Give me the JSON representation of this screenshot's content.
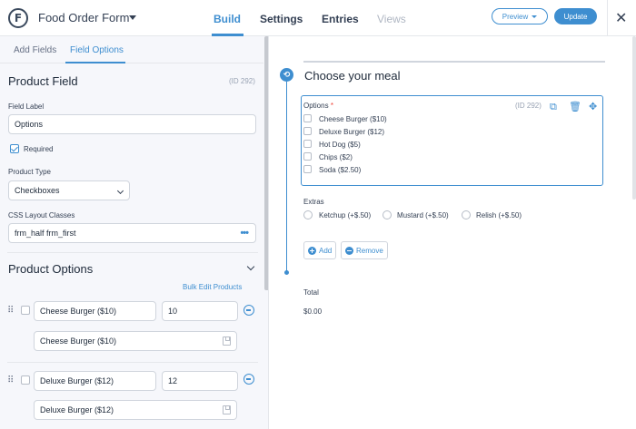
{
  "header": {
    "logo_letter": "F",
    "form_title": "Food Order Form",
    "tabs": [
      {
        "label": "Build",
        "state": "active"
      },
      {
        "label": "Settings",
        "state": "normal"
      },
      {
        "label": "Entries",
        "state": "normal"
      },
      {
        "label": "Views",
        "state": "disabled"
      }
    ],
    "preview_label": "Preview",
    "update_label": "Update",
    "close_glyph": "✕"
  },
  "sidebar": {
    "tabs": [
      {
        "label": "Add Fields"
      },
      {
        "label": "Field Options"
      }
    ],
    "product_field": {
      "title": "Product Field",
      "id_text": "(ID 292)",
      "field_label_label": "Field Label",
      "field_label_value": "Options",
      "required_label": "Required",
      "required_checked": true,
      "product_type_label": "Product Type",
      "product_type_value": "Checkboxes",
      "css_label": "CSS Layout Classes",
      "css_value": "frm_half frm_first",
      "dots_glyph": "•••"
    },
    "product_options": {
      "title": "Product Options",
      "bulk_edit_label": "Bulk Edit Products",
      "drag_glyph": "⠿",
      "items": [
        {
          "name": "Cheese Burger ($10)",
          "price": "10",
          "saved_value": "Cheese Burger ($10)"
        },
        {
          "name": "Deluxe Burger ($12)",
          "price": "12",
          "saved_value": "Deluxe Burger ($12)"
        }
      ]
    }
  },
  "canvas": {
    "section_title": "Choose your meal",
    "section_icon_glyph": "⟲",
    "options_field": {
      "label": "Options",
      "required_mark": "*",
      "id_text": "(ID 292)",
      "tool_icons": [
        "⧉",
        "🗑",
        "✥"
      ],
      "choices": [
        "Cheese Burger ($10)",
        "Deluxe Burger ($12)",
        "Hot Dog ($5)",
        "Chips ($2)",
        "Soda ($2.50)"
      ]
    },
    "extras": {
      "label": "Extras",
      "choices": [
        "Ketchup (+$.50)",
        "Mustard (+$.50)",
        "Relish (+$.50)"
      ]
    },
    "add_label": "Add",
    "remove_label": "Remove",
    "total_label": "Total",
    "total_value": "$0.00"
  },
  "colors": {
    "accent": "#3e8ed0",
    "required": "#f04438",
    "sidebar_bg": "#f6f7fb"
  }
}
